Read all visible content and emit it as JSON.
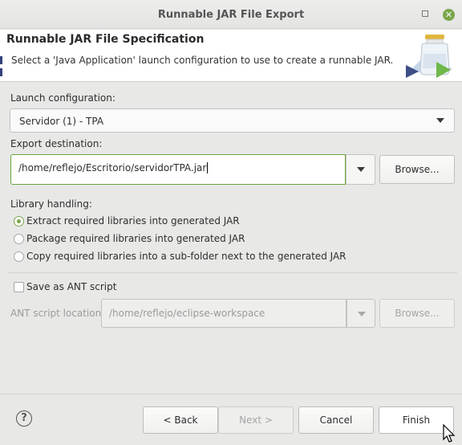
{
  "window": {
    "title": "Runnable JAR File Export",
    "restore_icon": "restore-icon",
    "close_icon": "close-icon",
    "close_glyph": "✕",
    "accent": "#7aa64a"
  },
  "header": {
    "title": "Runnable JAR File Specification",
    "description": "Select a 'Java Application' launch configuration to use to create a runnable JAR.",
    "icon": "jar-export-icon"
  },
  "launch": {
    "label": "Launch configuration:",
    "value": "Servidor (1) - TPA"
  },
  "export": {
    "label": "Export destination:",
    "value": "/home/reflejo/Escritorio/servidorTPA.jar",
    "browse_label": "Browse..."
  },
  "library": {
    "label": "Library handling:",
    "options": [
      {
        "label": "Extract required libraries into generated JAR",
        "checked": true
      },
      {
        "label": "Package required libraries into generated JAR",
        "checked": false
      },
      {
        "label": "Copy required libraries into a sub-folder next to the generated JAR",
        "checked": false
      }
    ]
  },
  "ant": {
    "checkbox_label": "Save as ANT script",
    "checked": false,
    "location_label": "ANT script location:",
    "location_value": "/home/reflejo/eclipse-workspace",
    "browse_label": "Browse..."
  },
  "footer": {
    "help_glyph": "?",
    "back_label": "< Back",
    "next_label": "Next >",
    "cancel_label": "Cancel",
    "finish_label": "Finish"
  }
}
